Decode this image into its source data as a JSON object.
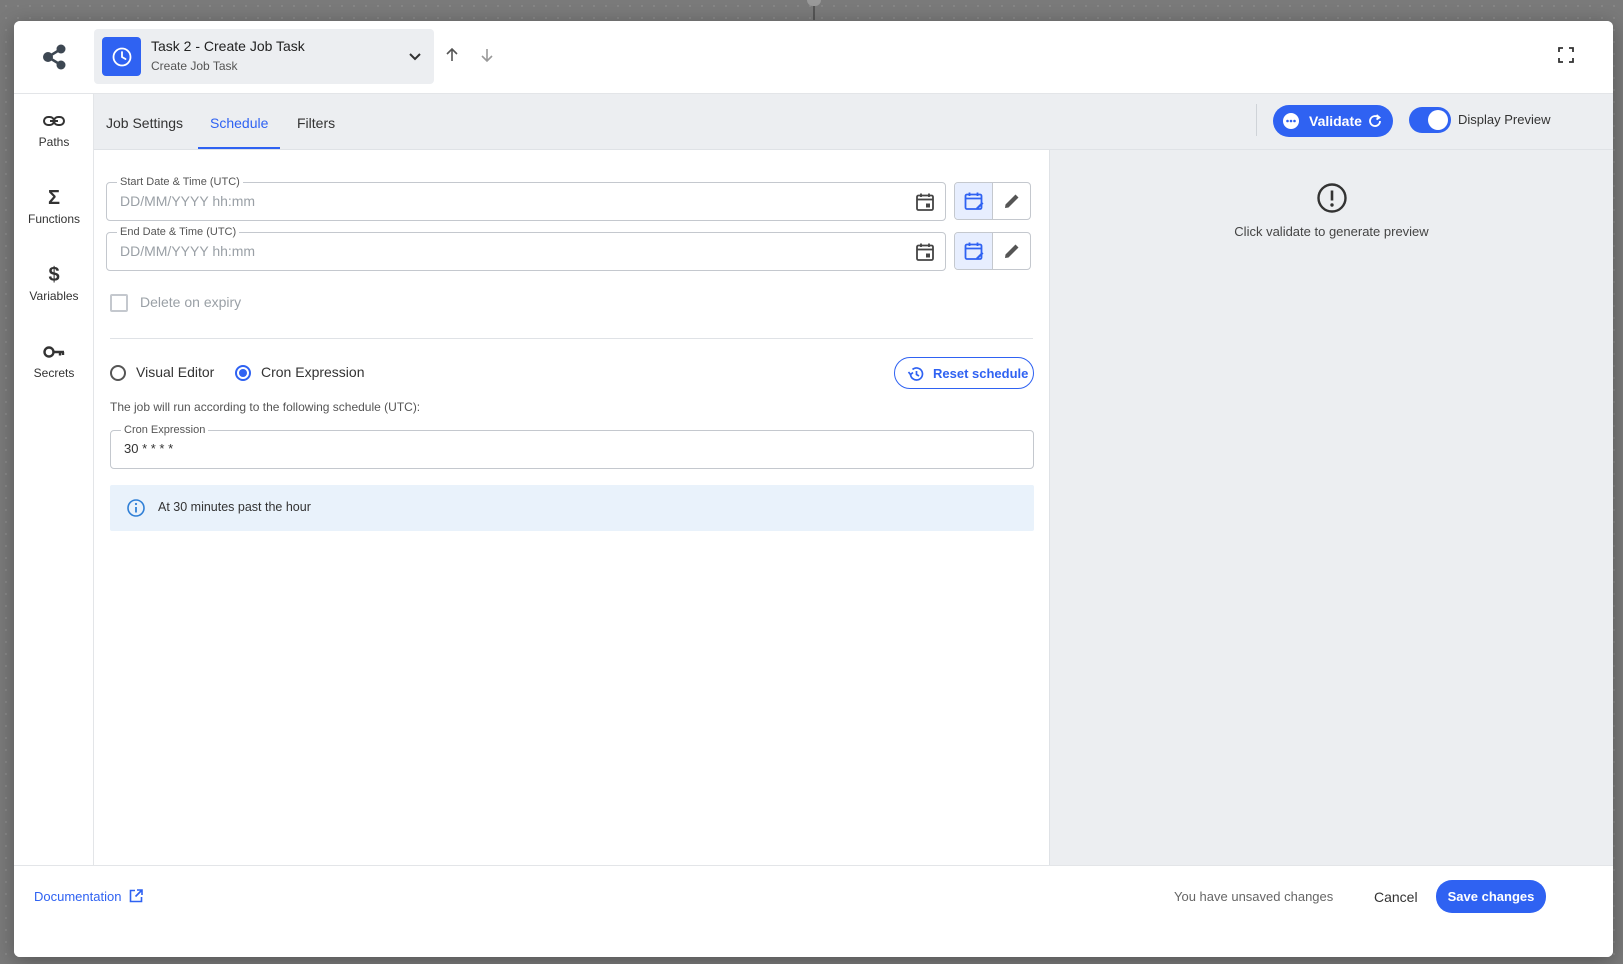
{
  "header": {
    "task_title": "Task 2 - Create Job Task",
    "task_subtitle": "Create Job Task"
  },
  "sidebar": {
    "items": [
      {
        "label": "Paths",
        "icon": "link-icon"
      },
      {
        "label": "Functions",
        "icon": "sigma-icon"
      },
      {
        "label": "Variables",
        "icon": "dollar-icon"
      },
      {
        "label": "Secrets",
        "icon": "key-icon"
      }
    ]
  },
  "tabs": [
    {
      "label": "Job Settings",
      "active": false
    },
    {
      "label": "Schedule",
      "active": true
    },
    {
      "label": "Filters",
      "active": false
    }
  ],
  "toolbar": {
    "validate_label": "Validate",
    "display_preview_label": "Display Preview",
    "display_preview_on": true
  },
  "schedule": {
    "start_label": "Start Date & Time (UTC)",
    "start_placeholder": "DD/MM/YYYY hh:mm",
    "end_label": "End Date & Time (UTC)",
    "end_placeholder": "DD/MM/YYYY hh:mm",
    "delete_on_expiry_label": "Delete on expiry",
    "delete_on_expiry_checked": false,
    "mode_visual_label": "Visual Editor",
    "mode_cron_label": "Cron Expression",
    "selected_mode": "cron",
    "reset_label": "Reset schedule",
    "description": "The job will run according to the following schedule (UTC):",
    "cron_label": "Cron Expression",
    "cron_value": "30 * * * *",
    "cron_summary": "At 30 minutes past the hour"
  },
  "preview": {
    "message": "Click validate to generate preview"
  },
  "footer": {
    "documentation_label": "Documentation",
    "unsaved_text": "You have unsaved changes",
    "cancel_label": "Cancel",
    "save_label": "Save changes"
  },
  "colors": {
    "accent": "#2f62f2",
    "info_bg": "#e9f2fb"
  }
}
